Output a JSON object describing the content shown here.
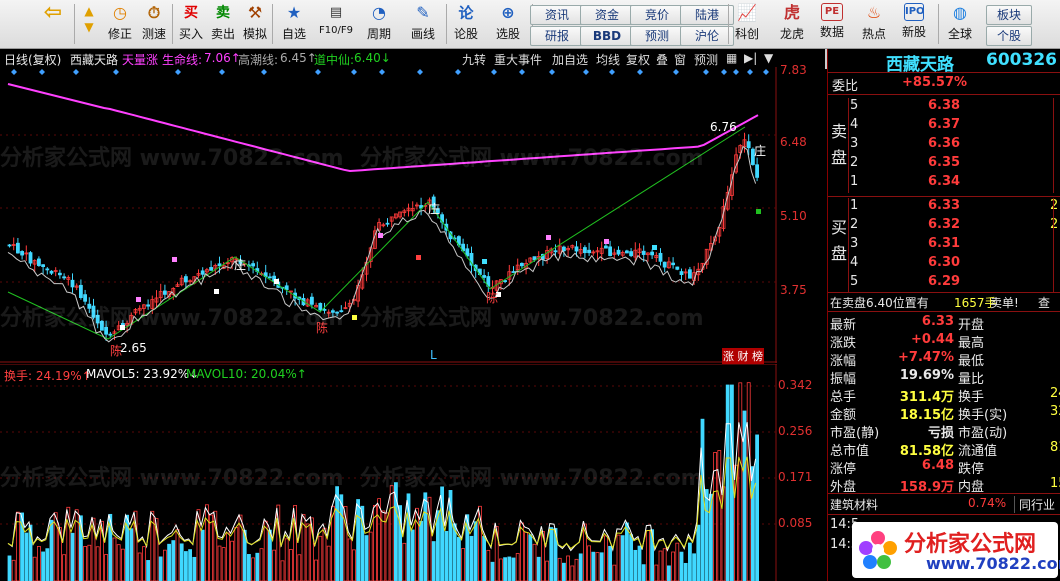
{
  "toolbar": {
    "buttons": [
      {
        "id": "back",
        "label": ""
      },
      {
        "id": "revise",
        "label": "修正"
      },
      {
        "id": "speedtest",
        "label": "测速"
      },
      {
        "id": "buy",
        "label": "买入",
        "icon": "买"
      },
      {
        "id": "sell",
        "label": "卖出",
        "icon": "卖"
      },
      {
        "id": "simulate",
        "label": "模拟"
      },
      {
        "id": "selfselect",
        "label": "自选"
      },
      {
        "id": "f10",
        "label": "F10/F9"
      },
      {
        "id": "period",
        "label": "周期"
      },
      {
        "id": "draw",
        "label": "画线"
      },
      {
        "id": "formula",
        "label": "论股",
        "icon": "论"
      },
      {
        "id": "select",
        "label": "选股"
      },
      {
        "id": "division",
        "label": "科创"
      },
      {
        "id": "longhu",
        "label": "龙虎"
      },
      {
        "id": "data",
        "label": "数据"
      },
      {
        "id": "hotspot",
        "label": "热点"
      },
      {
        "id": "newshare",
        "label": "新股"
      },
      {
        "id": "global",
        "label": "全球"
      }
    ],
    "small_buttons": [
      "资讯",
      "资金",
      "竞价",
      "陆港",
      "研报",
      "BBD",
      "预测",
      "沪伦"
    ],
    "right_buttons": [
      "板块",
      "个股"
    ]
  },
  "infobar": {
    "period": "日线(复权)",
    "stock": "西藏天路",
    "ind1": "天量涨",
    "ind2_label": "生命线:",
    "ind2_value": "7.06↑",
    "ind3_label": "高潮线:",
    "ind3_value": "6.45↑",
    "ind4_label": "道中仙:",
    "ind4_value": "6.40↓",
    "buttons": [
      "九转",
      "重大事件",
      "加自选",
      "均线",
      "复权",
      "叠",
      "窗",
      "预测"
    ]
  },
  "main_axis": [
    "7.83",
    "6.48",
    "5.10",
    "3.75"
  ],
  "main_labels": {
    "high": "6.76",
    "low": "2.65",
    "zhuang1": "庄",
    "zhuang2": "庄",
    "zhuang3": "庄",
    "chen1": "陈",
    "chen2": "陈",
    "chen3": "陈",
    "L": "L",
    "tags": "涨 财 榜"
  },
  "vol_header": {
    "label": "换手: 24.19%↑",
    "mavol5": "MAVOL5: 23.92%↓",
    "mavol10": "MAVOL10: 20.04%↑"
  },
  "vol_axis": [
    "0.342",
    "0.256",
    "0.171",
    "0.085"
  ],
  "quote": {
    "name": "西藏天路",
    "code": "600326",
    "weibi_label": "委比",
    "weibi_value": "+85.57%",
    "weicha_value": "",
    "sell_label": "卖盘",
    "buy_label": "买盘",
    "sell_orders": [
      {
        "lvl": "5",
        "price": "6.38"
      },
      {
        "lvl": "4",
        "price": "6.37"
      },
      {
        "lvl": "3",
        "price": "6.36"
      },
      {
        "lvl": "2",
        "price": "6.35"
      },
      {
        "lvl": "1",
        "price": "6.34"
      }
    ],
    "buy_orders": [
      {
        "lvl": "1",
        "price": "6.33",
        "vol": "2"
      },
      {
        "lvl": "2",
        "price": "6.32",
        "vol": "2"
      },
      {
        "lvl": "3",
        "price": "6.31",
        "vol": ""
      },
      {
        "lvl": "4",
        "price": "6.30",
        "vol": ""
      },
      {
        "lvl": "5",
        "price": "6.29",
        "vol": ""
      }
    ],
    "notice": "在卖盘6.40位置有",
    "notice_vol": "1657手",
    "notice_tail": "卖单!",
    "notice_more": "查",
    "stats": [
      {
        "l1": "最新",
        "v1": "6.33",
        "c1": "red",
        "l2": "开盘",
        "v2": ""
      },
      {
        "l1": "涨跌",
        "v1": "+0.44",
        "c1": "red",
        "l2": "最高",
        "v2": ""
      },
      {
        "l1": "涨幅",
        "v1": "+7.47%",
        "c1": "red",
        "l2": "最低",
        "v2": ""
      },
      {
        "l1": "振幅",
        "v1": "19.69%",
        "c1": "wht",
        "l2": "量比",
        "v2": ""
      },
      {
        "l1": "总手",
        "v1": "311.4万",
        "c1": "yel",
        "l2": "换手",
        "v2": "24"
      },
      {
        "l1": "金额",
        "v1": "18.15亿",
        "c1": "yel",
        "l2": "换手(实)",
        "v2": "32"
      },
      {
        "l1": "市盈(静)",
        "v1": "亏损",
        "c1": "wht",
        "l2": "市盈(动)",
        "v2": ""
      },
      {
        "l1": "总市值",
        "v1": "81.58亿",
        "c1": "yel",
        "l2": "流通值",
        "v2": "81."
      },
      {
        "l1": "涨停",
        "v1": "6.48",
        "c1": "red",
        "l2": "跌停",
        "v2": ""
      },
      {
        "l1": "外盘",
        "v1": "158.9万",
        "c1": "red",
        "l2": "内盘",
        "v2": "15"
      }
    ],
    "sector": "建筑材料",
    "sector_pct": "0.74%",
    "sector_rank": "同行业",
    "times": [
      "14:5",
      "14:5"
    ]
  },
  "watermark": "分析家公式网 www.70822.com",
  "logo_text": "分析家公式网",
  "logo_url": "www.70822.com",
  "colors": {
    "up": "#ff3b3b",
    "down": "#40d8ff",
    "lifeline": "#ff40ff",
    "trend": "#20c020"
  }
}
